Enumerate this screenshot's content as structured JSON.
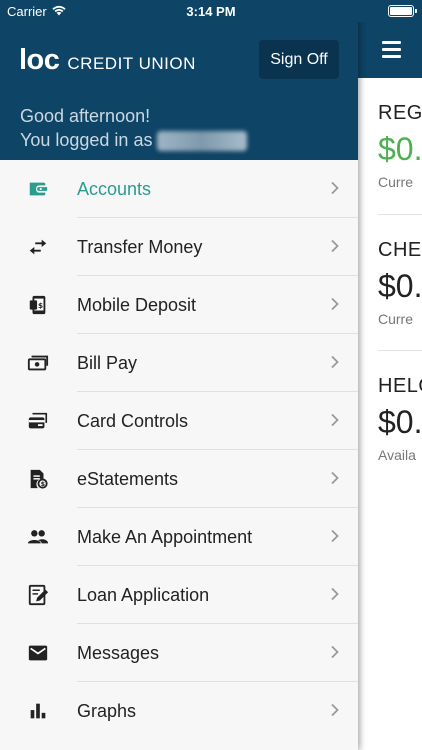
{
  "status_bar": {
    "carrier": "Carrier",
    "time": "3:14 PM"
  },
  "brand": {
    "logo_mark": "loc",
    "logo_text": "CREDIT UNION",
    "header_color": "#0e4466",
    "accent": "#2a9d8f"
  },
  "header": {
    "sign_off": "Sign Off",
    "greeting_line1": "Good afternoon!",
    "greeting_line2": "You logged in as"
  },
  "menu": {
    "items": [
      {
        "label": "Accounts",
        "icon": "wallet-icon",
        "active": true
      },
      {
        "label": "Transfer Money",
        "icon": "transfer-arrows-icon"
      },
      {
        "label": "Mobile Deposit",
        "icon": "mobile-deposit-icon"
      },
      {
        "label": "Bill Pay",
        "icon": "cash-icon"
      },
      {
        "label": "Card Controls",
        "icon": "credit-card-icon"
      },
      {
        "label": "eStatements",
        "icon": "statement-icon"
      },
      {
        "label": "Make An Appointment",
        "icon": "people-icon"
      },
      {
        "label": "Loan Application",
        "icon": "application-icon"
      },
      {
        "label": "Messages",
        "icon": "mail-icon"
      },
      {
        "label": "Graphs",
        "icon": "bar-chart-icon"
      }
    ]
  },
  "accounts_panel": {
    "accounts": [
      {
        "name": "REGU",
        "balance": "$0.",
        "sub": "Curre"
      },
      {
        "name": "CHEC",
        "balance": "$0.",
        "sub": "Curre"
      },
      {
        "name": "HELO",
        "balance": "$0.",
        "sub": "Availa"
      }
    ],
    "balance_green": "#4caf50"
  }
}
